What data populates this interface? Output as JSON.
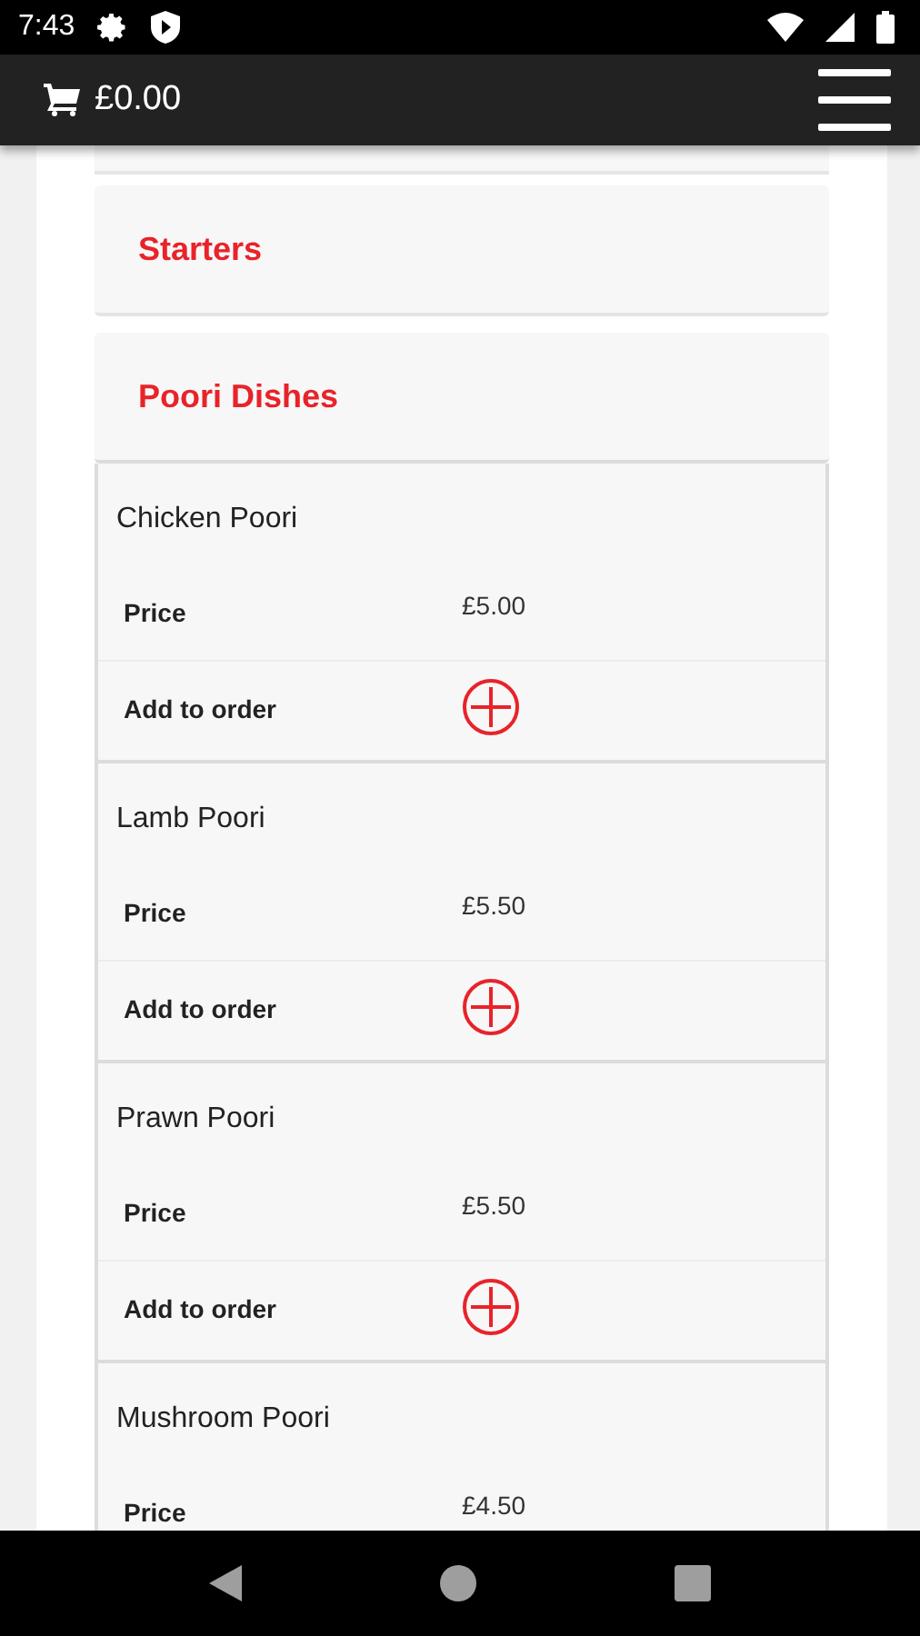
{
  "status_bar": {
    "time": "7:43"
  },
  "app_bar": {
    "cart_total": "£0.00"
  },
  "categories": [
    {
      "title": "Starters"
    },
    {
      "title": "Poori Dishes"
    }
  ],
  "dishes": [
    {
      "name": "Chicken Poori",
      "price_label": "Price",
      "price": "£5.00",
      "add_label": "Add to order"
    },
    {
      "name": "Lamb Poori",
      "price_label": "Price",
      "price": "£5.50",
      "add_label": "Add to order"
    },
    {
      "name": "Prawn Poori",
      "price_label": "Price",
      "price": "£5.50",
      "add_label": "Add to order"
    },
    {
      "name": "Mushroom Poori",
      "price_label": "Price",
      "price": "£4.50"
    }
  ]
}
